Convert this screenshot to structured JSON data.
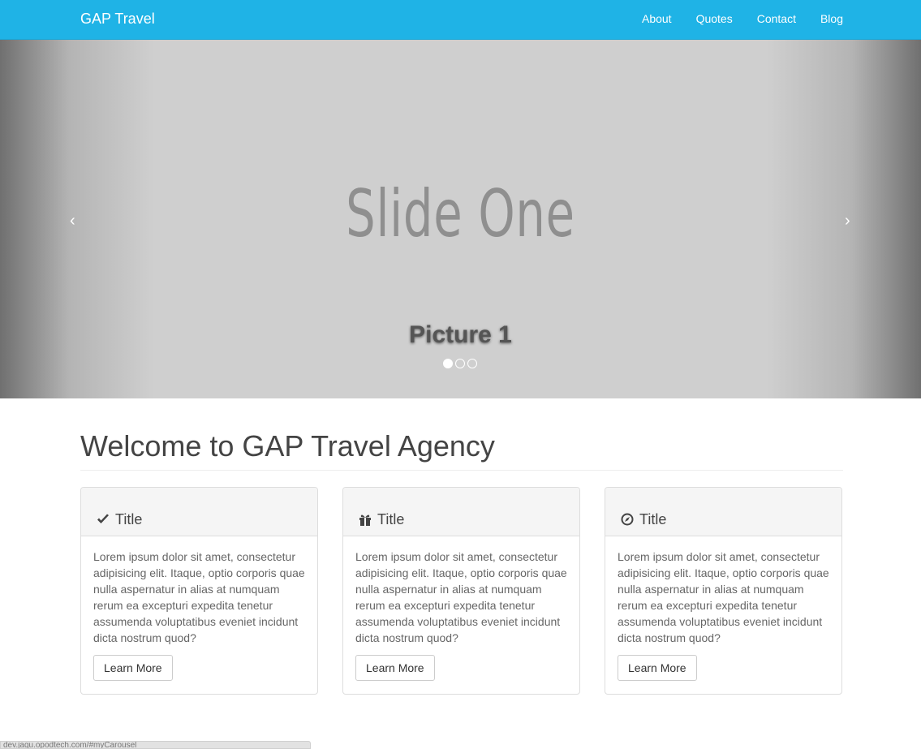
{
  "navbar": {
    "brand": "GAP Travel",
    "links": [
      "About",
      "Quotes",
      "Contact",
      "Blog"
    ],
    "color": "#1fb3e6"
  },
  "carousel": {
    "slide_text": "Slide One",
    "caption": "Picture 1",
    "prev_glyph": "‹",
    "next_glyph": "›",
    "indicator_count": 3,
    "active_index": 0
  },
  "main": {
    "heading": "Welcome to GAP Travel Agency",
    "panels": [
      {
        "icon": "check-icon",
        "title": "Title",
        "body": "Lorem ipsum dolor sit amet, consectetur adipisicing elit. Itaque, optio corporis quae nulla aspernatur in alias at numquam rerum ea excepturi expedita tenetur assumenda voluptatibus eveniet incidunt dicta nostrum quod?",
        "button": "Learn More"
      },
      {
        "icon": "gift-icon",
        "title": "Title",
        "body": "Lorem ipsum dolor sit amet, consectetur adipisicing elit. Itaque, optio corporis quae nulla aspernatur in alias at numquam rerum ea excepturi expedita tenetur assumenda voluptatibus eveniet incidunt dicta nostrum quod?",
        "button": "Learn More"
      },
      {
        "icon": "compass-icon",
        "title": "Title",
        "body": "Lorem ipsum dolor sit amet, consectetur adipisicing elit. Itaque, optio corporis quae nulla aspernatur in alias at numquam rerum ea excepturi expedita tenetur assumenda voluptatibus eveniet incidunt dicta nostrum quod?",
        "button": "Learn More"
      }
    ]
  },
  "statusbar": {
    "url": "dev.jaqu.opodtech.com/#myCarousel"
  }
}
